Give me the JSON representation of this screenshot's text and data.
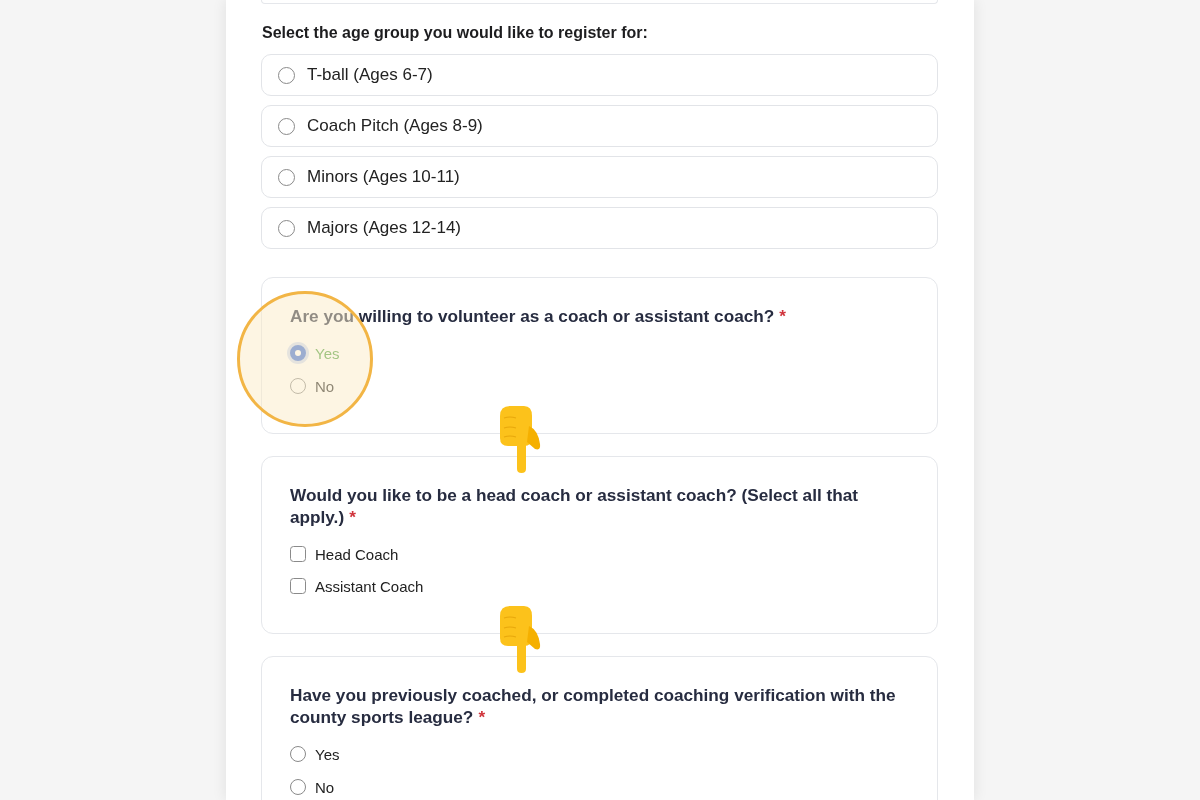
{
  "age_group": {
    "prompt": "Select the age group you would like to register for:",
    "options": [
      {
        "label": "T-ball (Ages 6-7)",
        "selected": false
      },
      {
        "label": "Coach Pitch (Ages 8-9)",
        "selected": false
      },
      {
        "label": "Minors (Ages 10-11)",
        "selected": false
      },
      {
        "label": "Majors (Ages 12-14)",
        "selected": false
      }
    ]
  },
  "questions": [
    {
      "kind": "radio",
      "prompt": "Are you willing to volunteer as a coach or assistant coach?",
      "required_mark": "*",
      "highlighted": true,
      "options": [
        {
          "label": "Yes",
          "selected": true
        },
        {
          "label": "No",
          "selected": false
        }
      ]
    },
    {
      "kind": "checkbox",
      "prompt": "Would you like to be a head coach or assistant coach? (Select all that apply.)",
      "required_mark": "*",
      "highlighted": false,
      "options": [
        {
          "label": "Head Coach",
          "checked": false
        },
        {
          "label": "Assistant Coach",
          "checked": false
        }
      ]
    },
    {
      "kind": "radio",
      "prompt": "Have you previously coached, or completed coaching verification with the county sports league?",
      "required_mark": "*",
      "highlighted": false,
      "options": [
        {
          "label": "Yes",
          "selected": false
        },
        {
          "label": "No",
          "selected": false
        }
      ]
    }
  ],
  "pointing_hands": [
    {
      "kind": "down"
    },
    {
      "kind": "down"
    }
  ]
}
